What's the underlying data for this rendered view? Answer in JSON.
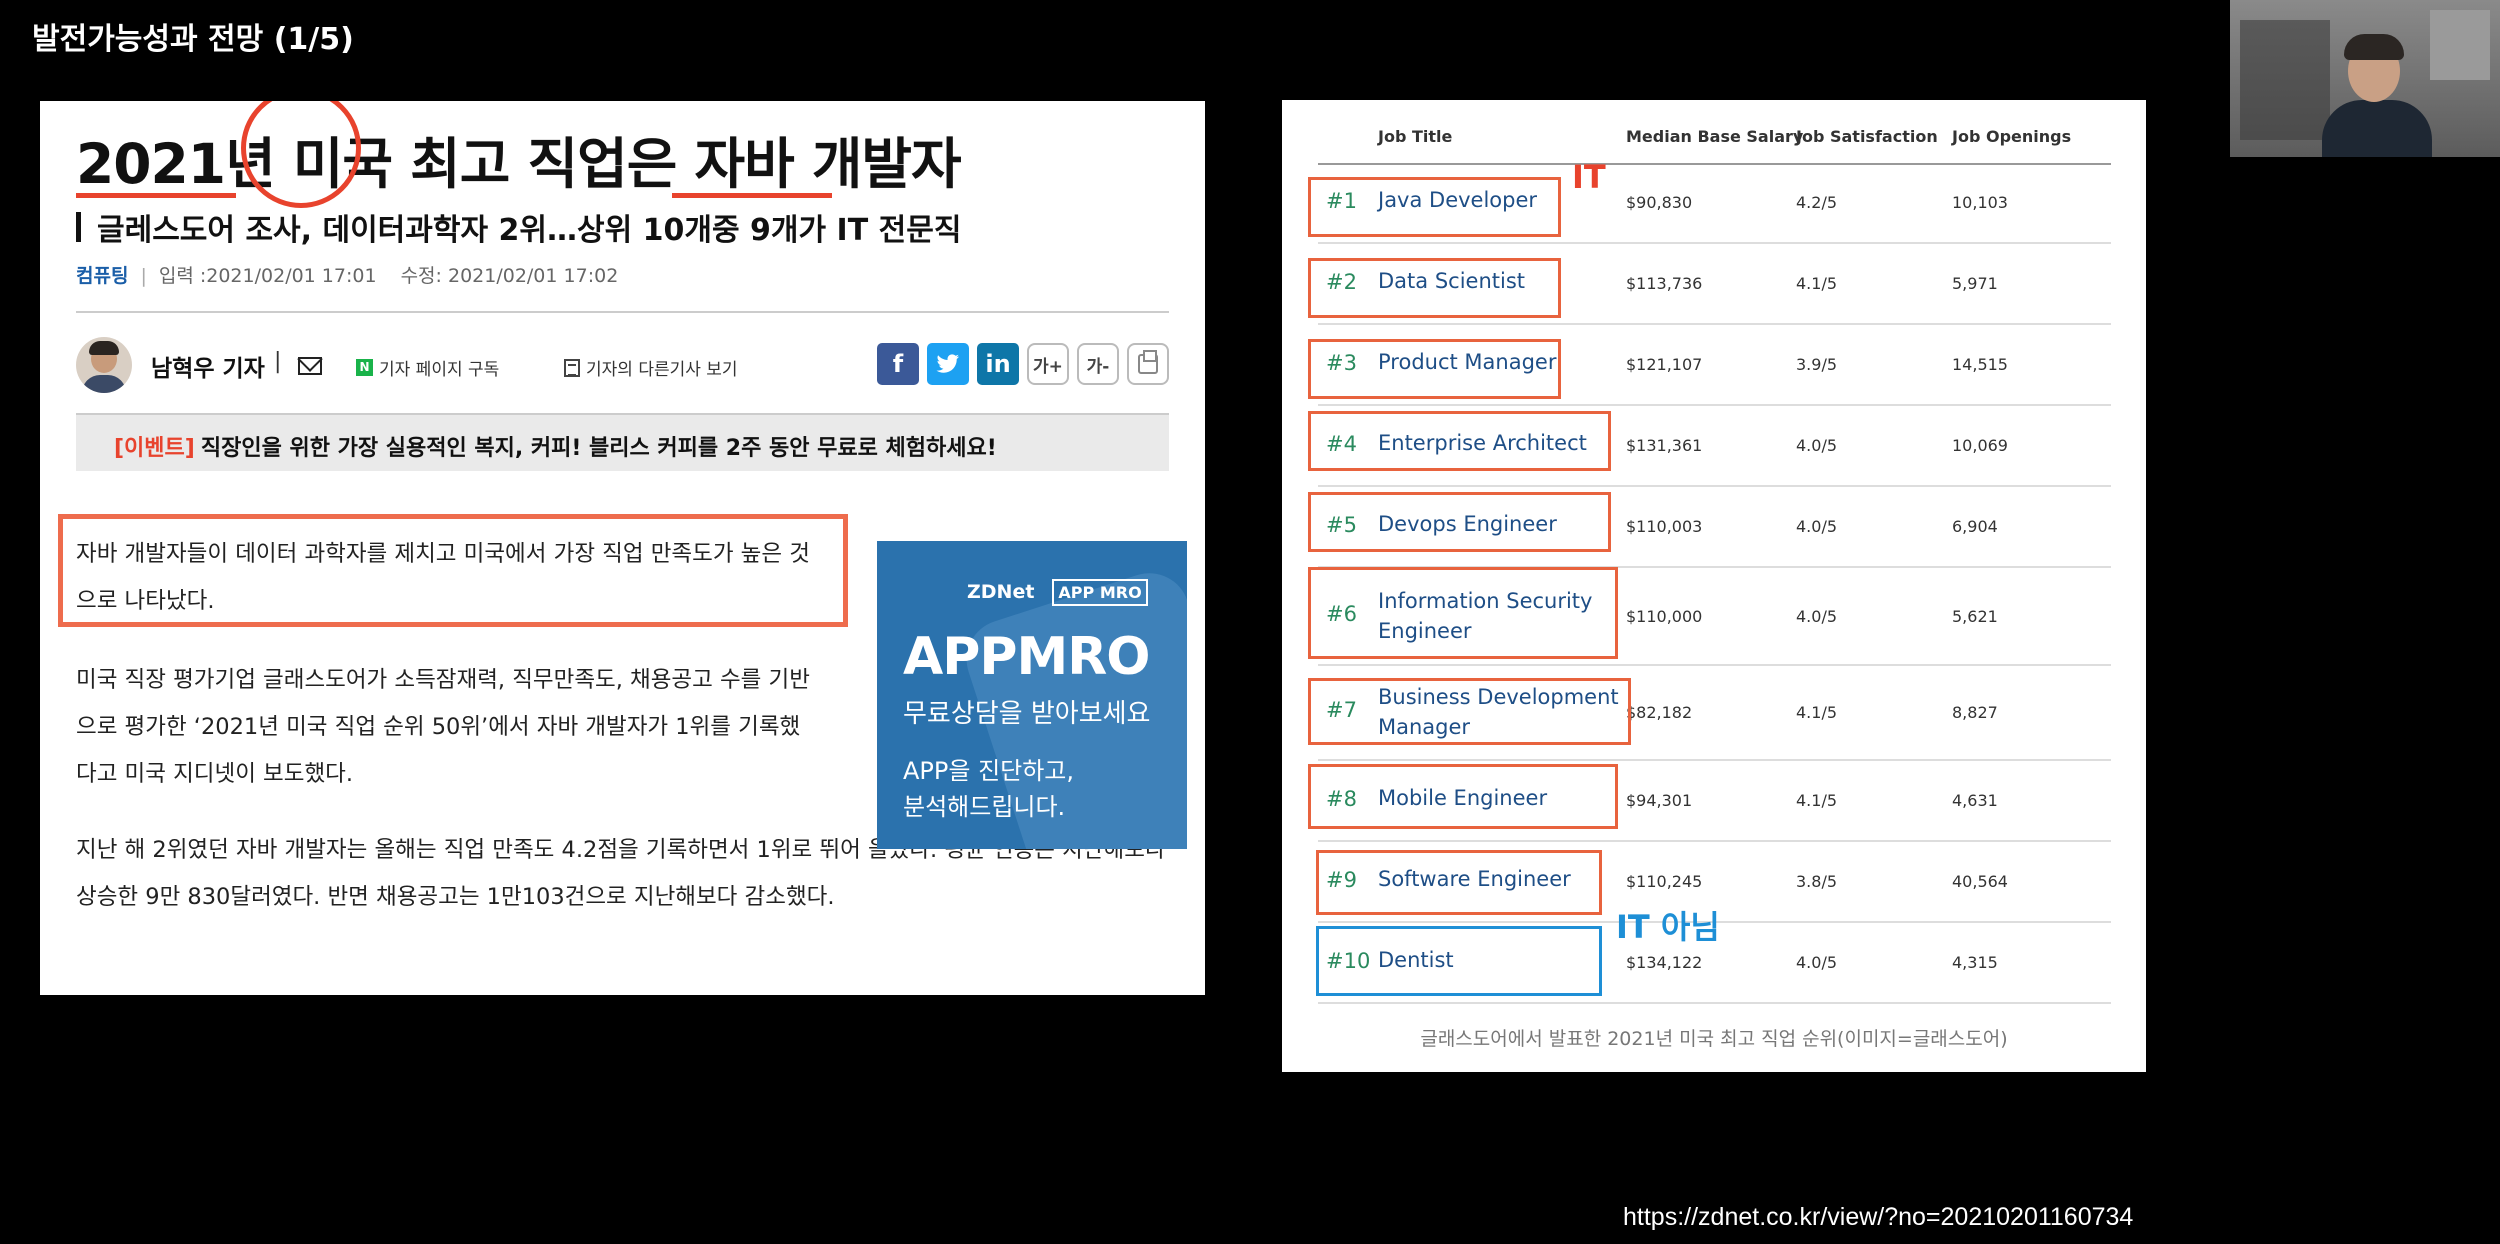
{
  "slide": {
    "title": "발전가능성과 전망 (1/5)"
  },
  "article": {
    "headline": "2021년 미국 최고 직업은 자바 개발자",
    "subtitle": "글레스도어 조사, 데이터과학자 2위…상위 10개중 9개가 IT 전문직",
    "category": "컴퓨팅",
    "input_date": "입력 :2021/02/01 17:01",
    "modified_date": "수정: 2021/02/01 17:02",
    "reporter": "남혁우 기자",
    "subscribe_label": "기자 페이지 구독",
    "more_articles_label": "기자의 다른기사 보기",
    "share": {
      "facebook": "f",
      "twitter": "t",
      "linkedin": "in",
      "font_up": "가+",
      "font_down": "가-"
    },
    "event_tag": "[이벤트]",
    "event_text": "직장인을 위한 가장 실용적인 복지, 커피! 블리스 커피를 2주 동안 무료로 체험하세요!",
    "paragraphs": [
      "자바 개발자들이 데이터 과학자를 제치고 미국에서 가장 직업 만족도가 높은 것으로 나타났다.",
      "미국 직장 평가기업 글래스도어가 소득잠재력, 직무만족도, 채용공고 수를 기반으로 평가한 ‘2021년 미국 직업 순위 50위’에서 자바 개발자가 1위를 기록했다고 미국 지디넷이 보도했다.",
      "지난 해 2위였던 자바 개발자는 올해는 직업 만족도 4.2점을 기록하면서 1위로 뛰어 올랐다. 평균 연봉은 지난해보다 상승한 9만 830달러였다. 반면 채용공고는 1만103건으로 지난해보다 감소했다."
    ],
    "ad": {
      "brand": "ZDNet",
      "brand2": "APP MRO",
      "headline": "APPMRO",
      "sub": "무료상담을 받아보세요",
      "line1": "APP을 진단하고,",
      "line2": "분석해드립니다."
    }
  },
  "ranking": {
    "headers": {
      "title": "Job Title",
      "salary": "Median Base Salary",
      "satisfaction": "Job Satisfaction",
      "openings": "Job Openings"
    },
    "rows": [
      {
        "rank": "#1",
        "title": "Java Developer",
        "salary": "$90,830",
        "satisfaction": "4.2/5",
        "openings": "10,103"
      },
      {
        "rank": "#2",
        "title": "Data Scientist",
        "salary": "$113,736",
        "satisfaction": "4.1/5",
        "openings": "5,971"
      },
      {
        "rank": "#3",
        "title": "Product Manager",
        "salary": "$121,107",
        "satisfaction": "3.9/5",
        "openings": "14,515"
      },
      {
        "rank": "#4",
        "title": "Enterprise Architect",
        "salary": "$131,361",
        "satisfaction": "4.0/5",
        "openings": "10,069"
      },
      {
        "rank": "#5",
        "title": "Devops Engineer",
        "salary": "$110,003",
        "satisfaction": "4.0/5",
        "openings": "6,904"
      },
      {
        "rank": "#6",
        "title": "Information Security Engineer",
        "title_l1": "Information Security",
        "title_l2": "Engineer",
        "salary": "$110,000",
        "satisfaction": "4.0/5",
        "openings": "5,621"
      },
      {
        "rank": "#7",
        "title": "Business Development Manager",
        "title_l1": "Business Development",
        "title_l2": "Manager",
        "salary": "$82,182",
        "satisfaction": "4.1/5",
        "openings": "8,827"
      },
      {
        "rank": "#8",
        "title": "Mobile Engineer",
        "salary": "$94,301",
        "satisfaction": "4.1/5",
        "openings": "4,631"
      },
      {
        "rank": "#9",
        "title": "Software Engineer",
        "salary": "$110,245",
        "satisfaction": "3.8/5",
        "openings": "40,564"
      },
      {
        "rank": "#10",
        "title": "Dentist",
        "salary": "$134,122",
        "satisfaction": "4.0/5",
        "openings": "4,315"
      }
    ],
    "it_label": "IT",
    "not_it_label": "IT 아님",
    "caption": "글래스도어에서 발표한 2021년 미국 최고 직업 순위(이미지=글래스도어)"
  },
  "source_url": "https://zdnet.co.kr/view/?no=20210201160734",
  "colors": {
    "highlight_red": "#e8432d",
    "highlight_blue": "#1e8fd6",
    "rank_green": "#2a8a5e",
    "title_blue": "#1e4e86"
  }
}
